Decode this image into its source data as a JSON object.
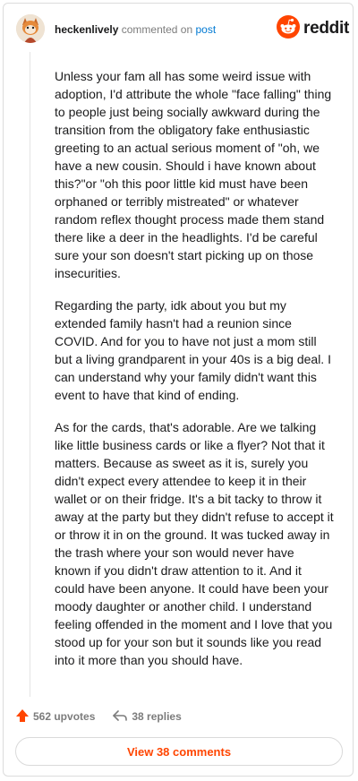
{
  "header": {
    "username": "heckenlively",
    "action": "commented on",
    "target": "post",
    "brand": "reddit"
  },
  "comment": {
    "paragraphs": [
      "Unless your fam all has some weird issue with adoption, I'd attribute the whole \"face falling\" thing to people just being socially awkward during the transition from the obligatory fake enthusiastic greeting to an actual serious moment of \"oh, we have a new cousin. Should i have known about this?\"or \"oh this poor little kid must have been orphaned or terribly mistreated\" or whatever random reflex thought process made them stand there like a deer in the headlights. I'd be careful sure your son doesn't start picking up on those insecurities.",
      "Regarding the party, idk about you but my extended family hasn't had a reunion since COVID. And for you to have not just a mom still but a living grandparent in your 40s is a big deal. I can understand why your family didn't want this event to have that kind of ending.",
      "As for the cards, that's adorable. Are we talking like little business cards or like a flyer? Not that it matters. Because as sweet as it is, surely you didn't expect every attendee to keep it in their wallet or on their fridge. It's a bit tacky to throw it away at the party but they didn't refuse to accept it or throw it in on the ground. It was tucked away in the trash where your son would never have known if you didn't draw attention to it. And it could have been anyone. It could have been your moody daughter or another child. I understand feeling offended in the moment and I love that you stood up for your son but it sounds like you read into it more than you should have."
    ]
  },
  "actions": {
    "upvotes": "562 upvotes",
    "replies": "38 replies"
  },
  "footer": {
    "view_comments": "View 38 comments"
  },
  "colors": {
    "accent": "#ff4500",
    "link": "#0079d3",
    "muted": "#7c7c7c"
  }
}
